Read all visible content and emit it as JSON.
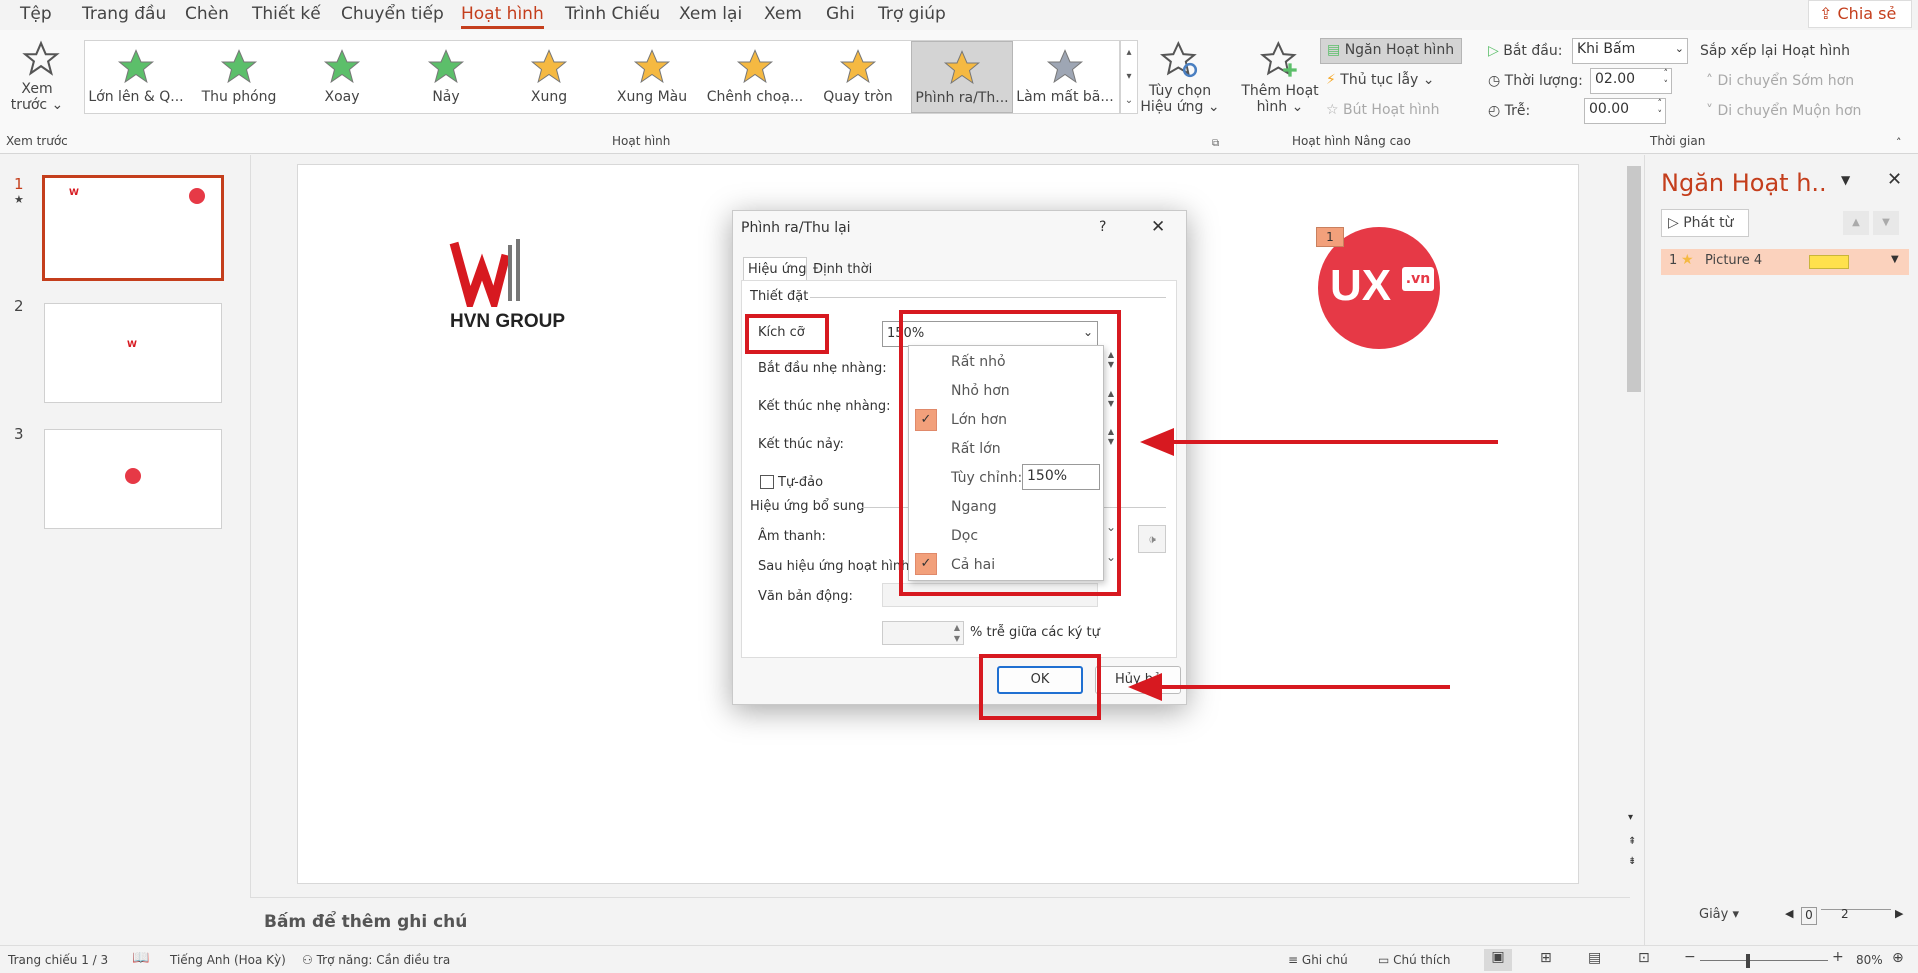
{
  "menu": {
    "tabs": [
      "Tệp",
      "Trang đầu",
      "Chèn",
      "Thiết kế",
      "Chuyển tiếp",
      "Hoạt hình",
      "Trình Chiếu",
      "Xem lại",
      "Xem",
      "Ghi",
      "Trợ giúp"
    ],
    "share": "Chia sẻ"
  },
  "ribbon": {
    "preview": {
      "label1": "Xem",
      "label2": "trước",
      "group": "Xem trước"
    },
    "animations": [
      {
        "label": "Lớn lên & Q...",
        "color": "#5cbf6a"
      },
      {
        "label": "Thu phóng",
        "color": "#5cbf6a"
      },
      {
        "label": "Xoay",
        "color": "#5cbf6a"
      },
      {
        "label": "Nảy",
        "color": "#5cbf6a"
      },
      {
        "label": "Xung",
        "color": "#f5b942"
      },
      {
        "label": "Xung Màu",
        "color": "#f5b942"
      },
      {
        "label": "Chênh choạ...",
        "color": "#f5b942"
      },
      {
        "label": "Quay tròn",
        "color": "#f5b942"
      },
      {
        "label": "Phình ra/Th...",
        "color": "#f5b942"
      },
      {
        "label": "Làm mất bã...",
        "color": "#9ea6b4"
      }
    ],
    "effect_options": {
      "label1": "Tùy chọn",
      "label2": "Hiệu ứng"
    },
    "animations_group": "Hoạt hình",
    "add_animation": {
      "label1": "Thêm Hoạt",
      "label2": "hình"
    },
    "pane": "Ngăn Hoạt hình",
    "trigger": "Thủ tục lẫy",
    "painter": "Bút Hoạt hình",
    "advanced_group": "Hoạt hình Nâng cao",
    "start_label": "Bắt đầu:",
    "start_value": "Khi Bấm",
    "duration_label": "Thời lượng:",
    "duration_value": "02.00",
    "delay_label": "Trễ:",
    "delay_value": "00.00",
    "reorder": "Sắp xếp lại Hoạt hình",
    "move_earlier": "Di chuyển Sớm hơn",
    "move_later": "Di chuyển Muộn hơn",
    "timing_group": "Thời gian"
  },
  "slides": {
    "numbers": [
      "1",
      "2",
      "3"
    ],
    "star": "★"
  },
  "canvas": {
    "logo_text": "HVN GROUP",
    "ux_text": "UX",
    "ux_suffix": ".vn",
    "anim_tag": "1"
  },
  "notes": "Bấm để thêm ghi chú",
  "pane": {
    "title": "Ngăn Hoạt h..",
    "play": "Phát từ",
    "item_num": "1",
    "item_label": "Picture 4",
    "seconds": "Giây",
    "scale_0": "0",
    "scale_2": "2"
  },
  "dialog": {
    "title": "Phình ra/Thu lại",
    "help": "?",
    "tab_effect": "Hiệu ứng",
    "tab_timing": "Định thời",
    "settings": "Thiết đặt",
    "size_label": "Kích cỡ",
    "size_value": "150%",
    "smooth_start": "Bắt đầu nhẹ nhàng:",
    "smooth_end": "Kết thúc nhẹ nhàng:",
    "bounce_end": "Kết thúc nảy:",
    "auto_reverse": "Tự-đảo",
    "enhancements": "Hiệu ứng bổ sung",
    "sound": "Âm thanh:",
    "after_anim": "Sau hiệu ứng hoạt hình:",
    "animate_text": "Văn bản động:",
    "delay_between": "% trễ giữa các ký tự",
    "ok": "OK",
    "cancel": "Hủy bỏ",
    "options": [
      "Rất nhỏ",
      "Nhỏ hơn",
      "Lớn hơn",
      "Rất lớn",
      "Tùy chỉnh:",
      "Ngang",
      "Dọc",
      "Cả hai"
    ],
    "custom_value": "150%"
  },
  "status": {
    "slide": "Trang chiếu 1 / 3",
    "lang": "Tiếng Anh (Hoa Kỳ)",
    "access": "Trợ năng: Cần điều tra",
    "notes": "Ghi chú",
    "comments": "Chú thích",
    "zoom": "80%"
  }
}
